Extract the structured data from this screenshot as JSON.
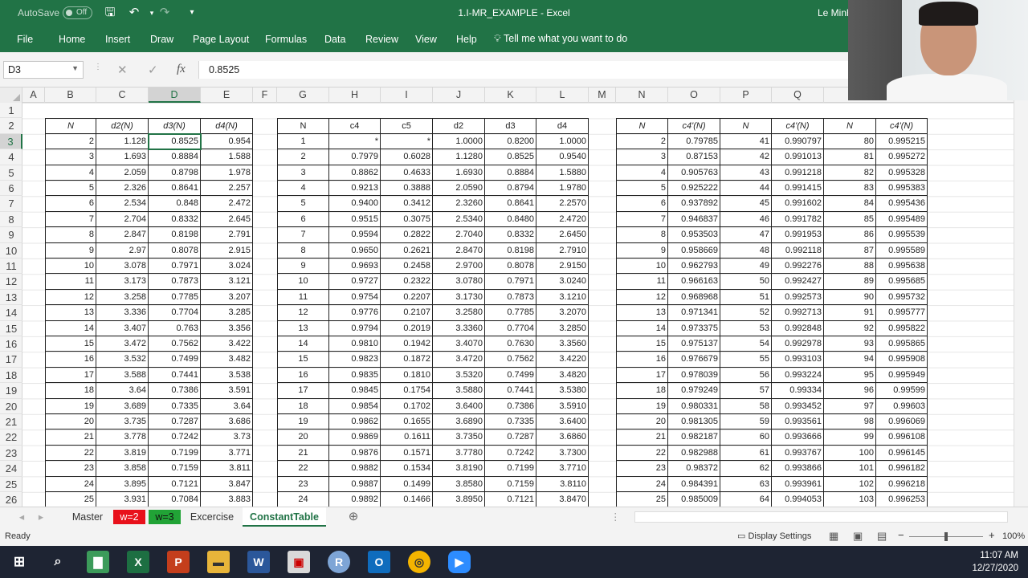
{
  "title_bar": {
    "autosave": "AutoSave",
    "autosave_state": "Off",
    "doc_title": "1.I-MR_EXAMPLE  -  Excel",
    "user": "Le Minh"
  },
  "ribbon": {
    "tabs": [
      "File",
      "Home",
      "Insert",
      "Draw",
      "Page Layout",
      "Formulas",
      "Data",
      "Review",
      "View",
      "Help"
    ],
    "tell_me": "Tell me what you want to do"
  },
  "formula_bar": {
    "name_box": "D3",
    "value": "0.8525"
  },
  "columns": [
    "A",
    "B",
    "C",
    "D",
    "E",
    "F",
    "G",
    "H",
    "I",
    "J",
    "K",
    "L",
    "M",
    "N",
    "O",
    "P",
    "Q"
  ],
  "rows": [
    "1",
    "2",
    "3",
    "4",
    "5",
    "6",
    "7",
    "8",
    "9",
    "10",
    "11",
    "12",
    "13",
    "14",
    "15",
    "16",
    "17",
    "18",
    "19",
    "20",
    "21",
    "22",
    "23",
    "24",
    "25",
    "26"
  ],
  "table1": {
    "headers": [
      "N",
      "d2(N)",
      "d3(N)",
      "d4(N)"
    ],
    "rows": [
      [
        "2",
        "1.128",
        "0.8525",
        "0.954"
      ],
      [
        "3",
        "1.693",
        "0.8884",
        "1.588"
      ],
      [
        "4",
        "2.059",
        "0.8798",
        "1.978"
      ],
      [
        "5",
        "2.326",
        "0.8641",
        "2.257"
      ],
      [
        "6",
        "2.534",
        "0.848",
        "2.472"
      ],
      [
        "7",
        "2.704",
        "0.8332",
        "2.645"
      ],
      [
        "8",
        "2.847",
        "0.8198",
        "2.791"
      ],
      [
        "9",
        "2.97",
        "0.8078",
        "2.915"
      ],
      [
        "10",
        "3.078",
        "0.7971",
        "3.024"
      ],
      [
        "11",
        "3.173",
        "0.7873",
        "3.121"
      ],
      [
        "12",
        "3.258",
        "0.7785",
        "3.207"
      ],
      [
        "13",
        "3.336",
        "0.7704",
        "3.285"
      ],
      [
        "14",
        "3.407",
        "0.763",
        "3.356"
      ],
      [
        "15",
        "3.472",
        "0.7562",
        "3.422"
      ],
      [
        "16",
        "3.532",
        "0.7499",
        "3.482"
      ],
      [
        "17",
        "3.588",
        "0.7441",
        "3.538"
      ],
      [
        "18",
        "3.64",
        "0.7386",
        "3.591"
      ],
      [
        "19",
        "3.689",
        "0.7335",
        "3.64"
      ],
      [
        "20",
        "3.735",
        "0.7287",
        "3.686"
      ],
      [
        "21",
        "3.778",
        "0.7242",
        "3.73"
      ],
      [
        "22",
        "3.819",
        "0.7199",
        "3.771"
      ],
      [
        "23",
        "3.858",
        "0.7159",
        "3.811"
      ],
      [
        "24",
        "3.895",
        "0.7121",
        "3.847"
      ],
      [
        "25",
        "3.931",
        "0.7084",
        "3.883"
      ]
    ]
  },
  "table2": {
    "headers": [
      "N",
      "c4",
      "c5",
      "d2",
      "d3",
      "d4"
    ],
    "rows": [
      [
        "1",
        "*",
        "*",
        "1.0000",
        "0.8200",
        "1.0000"
      ],
      [
        "2",
        "0.7979",
        "0.6028",
        "1.1280",
        "0.8525",
        "0.9540"
      ],
      [
        "3",
        "0.8862",
        "0.4633",
        "1.6930",
        "0.8884",
        "1.5880"
      ],
      [
        "4",
        "0.9213",
        "0.3888",
        "2.0590",
        "0.8794",
        "1.9780"
      ],
      [
        "5",
        "0.9400",
        "0.3412",
        "2.3260",
        "0.8641",
        "2.2570"
      ],
      [
        "6",
        "0.9515",
        "0.3075",
        "2.5340",
        "0.8480",
        "2.4720"
      ],
      [
        "7",
        "0.9594",
        "0.2822",
        "2.7040",
        "0.8332",
        "2.6450"
      ],
      [
        "8",
        "0.9650",
        "0.2621",
        "2.8470",
        "0.8198",
        "2.7910"
      ],
      [
        "9",
        "0.9693",
        "0.2458",
        "2.9700",
        "0.8078",
        "2.9150"
      ],
      [
        "10",
        "0.9727",
        "0.2322",
        "3.0780",
        "0.7971",
        "3.0240"
      ],
      [
        "11",
        "0.9754",
        "0.2207",
        "3.1730",
        "0.7873",
        "3.1210"
      ],
      [
        "12",
        "0.9776",
        "0.2107",
        "3.2580",
        "0.7785",
        "3.2070"
      ],
      [
        "13",
        "0.9794",
        "0.2019",
        "3.3360",
        "0.7704",
        "3.2850"
      ],
      [
        "14",
        "0.9810",
        "0.1942",
        "3.4070",
        "0.7630",
        "3.3560"
      ],
      [
        "15",
        "0.9823",
        "0.1872",
        "3.4720",
        "0.7562",
        "3.4220"
      ],
      [
        "16",
        "0.9835",
        "0.1810",
        "3.5320",
        "0.7499",
        "3.4820"
      ],
      [
        "17",
        "0.9845",
        "0.1754",
        "3.5880",
        "0.7441",
        "3.5380"
      ],
      [
        "18",
        "0.9854",
        "0.1702",
        "3.6400",
        "0.7386",
        "3.5910"
      ],
      [
        "19",
        "0.9862",
        "0.1655",
        "3.6890",
        "0.7335",
        "3.6400"
      ],
      [
        "20",
        "0.9869",
        "0.1611",
        "3.7350",
        "0.7287",
        "3.6860"
      ],
      [
        "21",
        "0.9876",
        "0.1571",
        "3.7780",
        "0.7242",
        "3.7300"
      ],
      [
        "22",
        "0.9882",
        "0.1534",
        "3.8190",
        "0.7199",
        "3.7710"
      ],
      [
        "23",
        "0.9887",
        "0.1499",
        "3.8580",
        "0.7159",
        "3.8110"
      ],
      [
        "24",
        "0.9892",
        "0.1466",
        "3.8950",
        "0.7121",
        "3.8470"
      ]
    ]
  },
  "table3": {
    "headers": [
      "N",
      "c4'(N)",
      "N",
      "c4'(N)",
      "N",
      "c4'(N)"
    ],
    "rows": [
      [
        "2",
        "0.79785",
        "41",
        "0.990797",
        "80",
        "0.995215"
      ],
      [
        "3",
        "0.87153",
        "42",
        "0.991013",
        "81",
        "0.995272"
      ],
      [
        "4",
        "0.905763",
        "43",
        "0.991218",
        "82",
        "0.995328"
      ],
      [
        "5",
        "0.925222",
        "44",
        "0.991415",
        "83",
        "0.995383"
      ],
      [
        "6",
        "0.937892",
        "45",
        "0.991602",
        "84",
        "0.995436"
      ],
      [
        "7",
        "0.946837",
        "46",
        "0.991782",
        "85",
        "0.995489"
      ],
      [
        "8",
        "0.953503",
        "47",
        "0.991953",
        "86",
        "0.995539"
      ],
      [
        "9",
        "0.958669",
        "48",
        "0.992118",
        "87",
        "0.995589"
      ],
      [
        "10",
        "0.962793",
        "49",
        "0.992276",
        "88",
        "0.995638"
      ],
      [
        "11",
        "0.966163",
        "50",
        "0.992427",
        "89",
        "0.995685"
      ],
      [
        "12",
        "0.968968",
        "51",
        "0.992573",
        "90",
        "0.995732"
      ],
      [
        "13",
        "0.971341",
        "52",
        "0.992713",
        "91",
        "0.995777"
      ],
      [
        "14",
        "0.973375",
        "53",
        "0.992848",
        "92",
        "0.995822"
      ],
      [
        "15",
        "0.975137",
        "54",
        "0.992978",
        "93",
        "0.995865"
      ],
      [
        "16",
        "0.976679",
        "55",
        "0.993103",
        "94",
        "0.995908"
      ],
      [
        "17",
        "0.978039",
        "56",
        "0.993224",
        "95",
        "0.995949"
      ],
      [
        "18",
        "0.979249",
        "57",
        "0.99334",
        "96",
        "0.99599"
      ],
      [
        "19",
        "0.980331",
        "58",
        "0.993452",
        "97",
        "0.99603"
      ],
      [
        "20",
        "0.981305",
        "59",
        "0.993561",
        "98",
        "0.996069"
      ],
      [
        "21",
        "0.982187",
        "60",
        "0.993666",
        "99",
        "0.996108"
      ],
      [
        "22",
        "0.982988",
        "61",
        "0.993767",
        "100",
        "0.996145"
      ],
      [
        "23",
        "0.98372",
        "62",
        "0.993866",
        "101",
        "0.996182"
      ],
      [
        "24",
        "0.984391",
        "63",
        "0.993961",
        "102",
        "0.996218"
      ],
      [
        "25",
        "0.985009",
        "64",
        "0.994053",
        "103",
        "0.996253"
      ]
    ]
  },
  "sheet_tabs": [
    "Master",
    "w=2",
    "w=3",
    "Excercise",
    "ConstantTable"
  ],
  "status": {
    "ready": "Ready",
    "display_settings": "Display Settings",
    "zoom": "100%",
    "zoom_level": 1.0
  },
  "taskbar": {
    "time": "11:07 AM",
    "date": "12/27/2020"
  },
  "colors": {
    "excel_green": "#217346",
    "tab_red": "#e8111b",
    "tab_green": "#21a336"
  }
}
